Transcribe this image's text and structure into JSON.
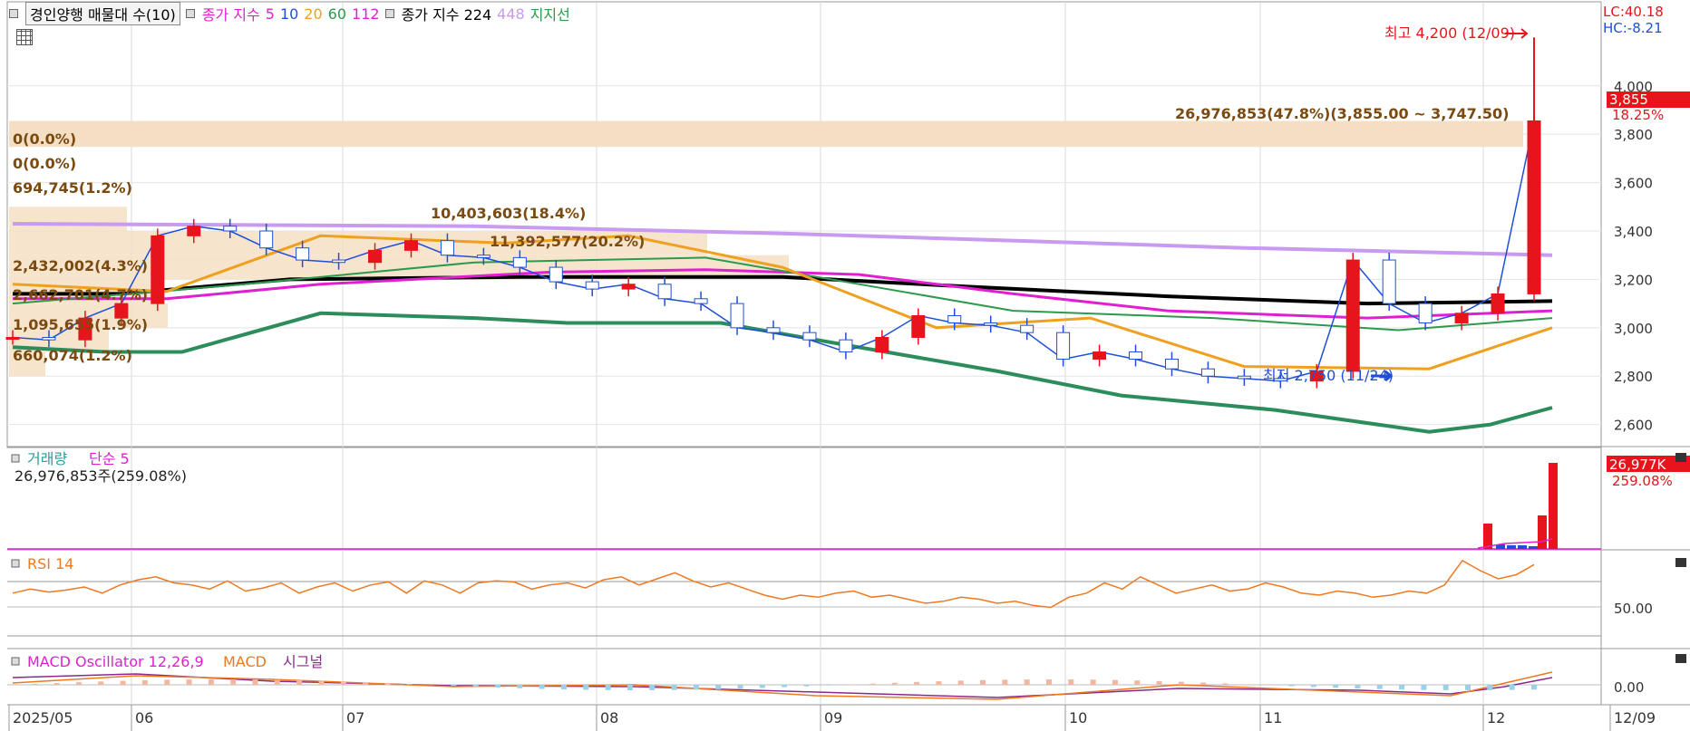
{
  "legend": {
    "item1": "경인양행 매물대 수(10)",
    "ma_label": "종가 지수",
    "ma_periods": [
      "5",
      "10",
      "20",
      "60",
      "112"
    ],
    "ma_colors": [
      "#1f4fd6",
      "#1f4fd6",
      "#f0a020",
      "#2c9a4c",
      "#e020d0"
    ],
    "long_label": "종가 지수 224",
    "long2": "448",
    "support": "지지선"
  },
  "right_top": {
    "lc": "LC:40.18",
    "hc": "HC:-8.21"
  },
  "price_axis": {
    "ticks": [
      "4,000",
      "3,800",
      "3,600",
      "3,400",
      "3,200",
      "3,000",
      "2,800",
      "2,600"
    ],
    "values": [
      4000,
      3800,
      3600,
      3400,
      3200,
      3000,
      2800,
      2600
    ]
  },
  "current": {
    "price": "3,855",
    "change": "18.25%"
  },
  "annotations": {
    "high": "최고 4,200 (12/09)",
    "low": "최저 2,750 (11/24)",
    "volume_profile_top": "26,976,853(47.8%)(3,855.00 ~ 3,747.50)",
    "vp_labels": [
      "0(0.0%)",
      "0(0.0%)",
      "694,745(1.2%)",
      "10,403,603(18.4%)",
      "11,392,577(20.2%)",
      "2,432,002(4.3%)",
      "2,662,701(4.7%)",
      "1,095,655(1.9%)",
      "660,074(1.2%)"
    ]
  },
  "volume_panel": {
    "title": "거래량",
    "ma": "단순 5",
    "value_text": "26,976,853주(259.08%)",
    "badge": "26,977K",
    "badge_pct": "259.08%"
  },
  "rsi_panel": {
    "title": "RSI 14",
    "tick": "50.00"
  },
  "macd_panel": {
    "title": "MACD Oscillator 12,26,9",
    "macd": "MACD",
    "signal": "시그널",
    "tick": "0.00"
  },
  "x_axis": {
    "labels": [
      "2025/05",
      "06",
      "07",
      "08",
      "09",
      "10",
      "11",
      "12",
      "12/09"
    ]
  },
  "colors": {
    "up": "#e8141b",
    "down": "#1f4fd6",
    "ma5": "#1f4fd6",
    "ma20": "#f0a020",
    "ma60": "#2c9a4c",
    "ma112": "#e020d0",
    "ma224": "#000000",
    "ma448": "#c89af0",
    "support": "#2c8c5c",
    "rsi": "#f07820",
    "vp": "#f5dfc4"
  },
  "chart_data": {
    "type": "candlestick",
    "title": "경인양행 매물대 수(10)",
    "ylim": [
      2550,
      4250
    ],
    "x": [
      "05",
      "06",
      "07",
      "08",
      "09",
      "10",
      "11",
      "12"
    ],
    "high": 4200,
    "low": 2750,
    "close": [
      2960,
      2950,
      3040,
      3100,
      3380,
      3420,
      3400,
      3330,
      3280,
      3270,
      3320,
      3360,
      3300,
      3290,
      3250,
      3190,
      3160,
      3180,
      3120,
      3100,
      3000,
      2980,
      2950,
      2900,
      2960,
      3050,
      3020,
      3010,
      2980,
      2870,
      2900,
      2870,
      2830,
      2800,
      2790,
      2780,
      2820,
      3280,
      3100,
      3020,
      3060,
      3140,
      3855
    ],
    "ma448": 3310
  }
}
